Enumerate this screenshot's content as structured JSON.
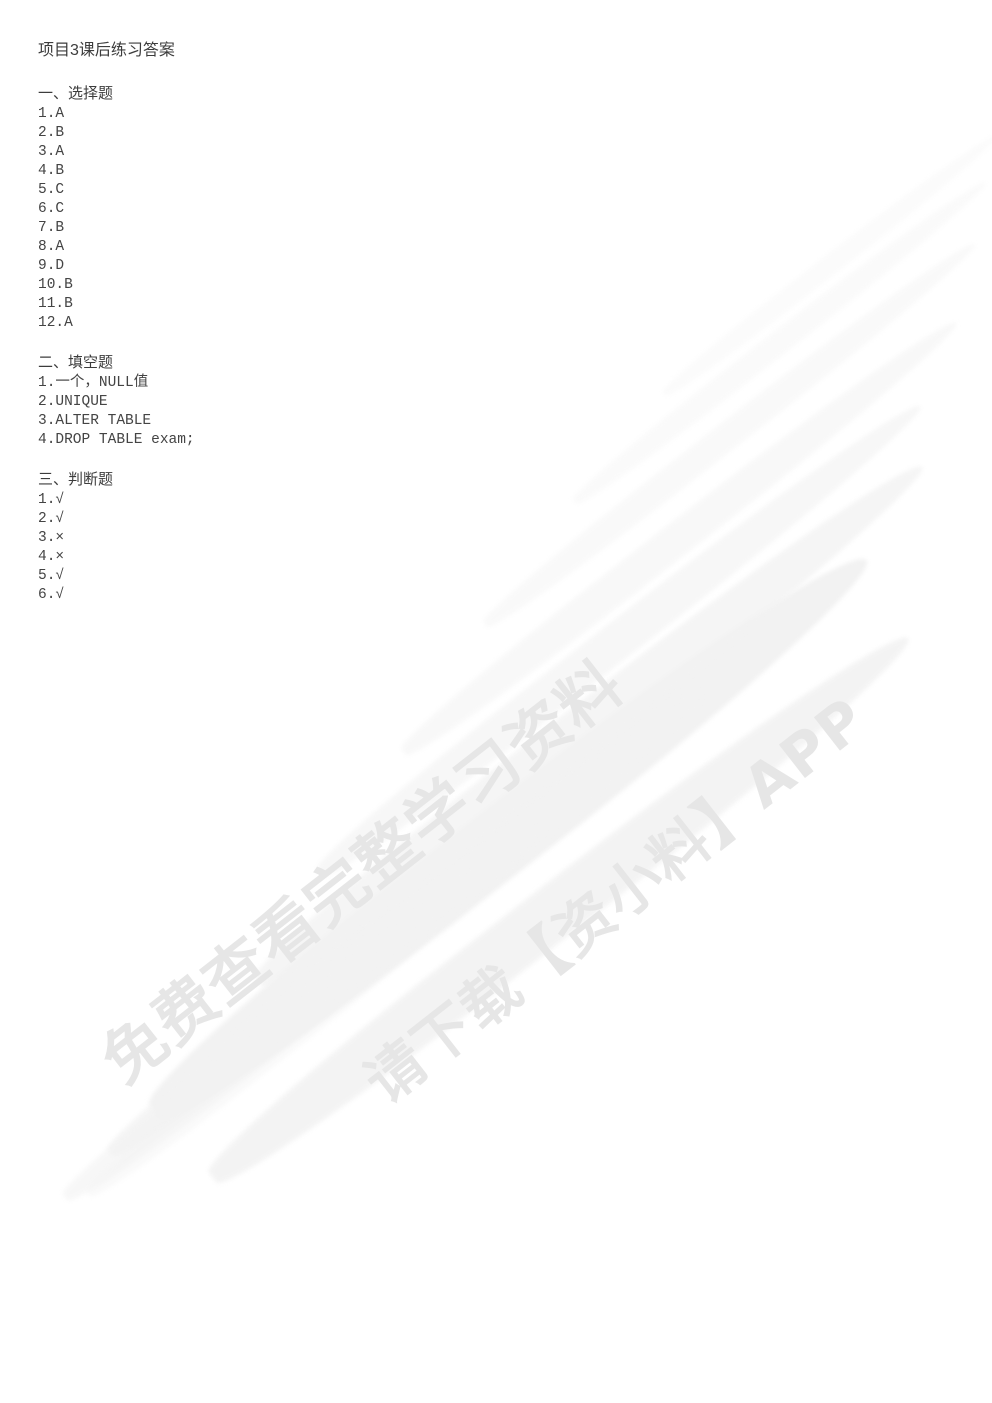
{
  "document": {
    "title": "项目3课后练习答案"
  },
  "sections": [
    {
      "heading": "一、选择题",
      "items": [
        "1.A",
        "2.B",
        "3.A",
        "4.B",
        "5.C",
        "6.C",
        "7.B",
        "8.A",
        "9.D",
        "10.B",
        "11.B",
        "12.A"
      ]
    },
    {
      "heading": "二、填空题",
      "items": [
        "1.一个，NULL值",
        "2.UNIQUE",
        "3.ALTER TABLE",
        "4.DROP TABLE exam;"
      ]
    },
    {
      "heading": "三、判断题",
      "items": [
        "1.√",
        "2.√",
        "3.×",
        "4.×",
        "5.√",
        "6.√"
      ]
    }
  ],
  "watermark": {
    "line1": "免费查看完整学习资料",
    "line2": "请下载【资小料】APP",
    "color": "#e6e6e6",
    "brush_color": "#f2f2f2"
  },
  "colors": {
    "page_background": "#ffffff",
    "title_text": "#3c3c3c",
    "body_text": "#444444"
  }
}
